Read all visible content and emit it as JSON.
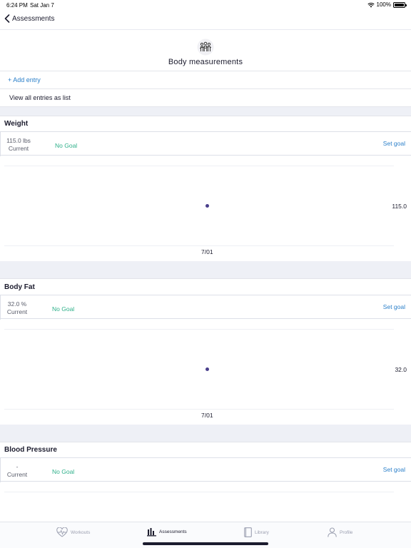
{
  "status": {
    "time": "6:24 PM",
    "date": "Sat Jan 7",
    "battery": "100%"
  },
  "nav": {
    "back_label": "Assessments"
  },
  "hero": {
    "title": "Body measurements",
    "icon": "group-people-icon"
  },
  "actions": {
    "add_entry": "+ Add entry",
    "view_all": "View all entries as list"
  },
  "sections": [
    {
      "title": "Weight",
      "current_value": "115.0 lbs",
      "current_label": "Current",
      "goal_text": "No Goal",
      "set_goal_label": "Set goal",
      "chart_data": {
        "type": "scatter",
        "x": [
          "7/01"
        ],
        "values": [
          115.0
        ],
        "y_labels": [
          "115.0"
        ]
      }
    },
    {
      "title": "Body Fat",
      "current_value": "32.0 %",
      "current_label": "Current",
      "goal_text": "No Goal",
      "set_goal_label": "Set goal",
      "chart_data": {
        "type": "scatter",
        "x": [
          "7/01"
        ],
        "values": [
          32.0
        ],
        "y_labels": [
          "32.0"
        ]
      }
    },
    {
      "title": "Blood Pressure",
      "current_value": "-",
      "current_label": "Current",
      "goal_text": "No Goal",
      "set_goal_label": "Set goal"
    }
  ],
  "tabs": [
    {
      "label": "Workouts",
      "icon": "heart-pulse-icon",
      "active": false
    },
    {
      "label": "Assessments",
      "icon": "bar-chart-icon",
      "active": true
    },
    {
      "label": "Library",
      "icon": "book-icon",
      "active": false
    },
    {
      "label": "Profile",
      "icon": "person-icon",
      "active": false
    }
  ]
}
